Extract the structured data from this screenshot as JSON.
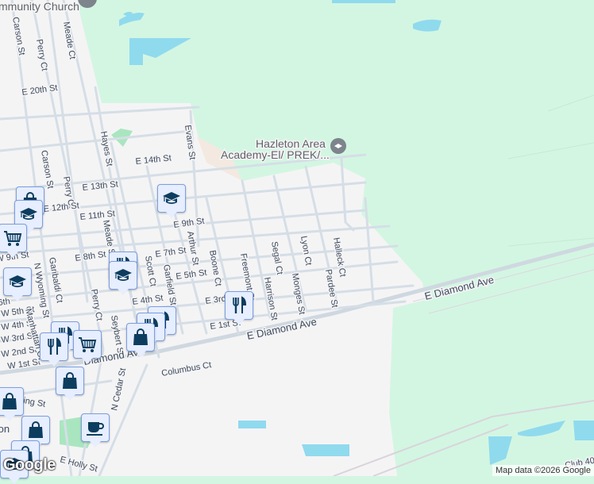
{
  "map": {
    "poi_top": "mmunity Church",
    "school_poi": {
      "line1": "Hazleton Area",
      "line2": "Academy-El/ PREK/..."
    },
    "streets": {
      "carson_n": "Carson St",
      "perry_n": "Perry Ct",
      "meade_ct": "Meade Ct",
      "e20": "E 20th St",
      "hayes": "Hayes St",
      "evans": "Evans St",
      "e14": "E 14th St",
      "e13": "E 13th St",
      "carson_s": "Carson St",
      "perry_s": "Perry Ct",
      "e12": "E 12th St",
      "e11": "E 11th St",
      "e9": "E 9th St",
      "meade_st": "Meade St",
      "arthur": "Arthur St",
      "e8": "E 8th St",
      "e7": "E 7th St",
      "scott": "Scott Ct",
      "garfield": "Garfield St",
      "e5": "E 5th St",
      "boone": "Boone Ct",
      "freemont": "Freemont St",
      "harrison": "Harrison St",
      "segal": "Segal Ct",
      "lyon": "Lyon Ct",
      "monges": "Monges St",
      "halleck": "Halleck Ct",
      "pardee": "Pardee St",
      "e4": "E 4th St",
      "e3": "E 3rd St",
      "e1": "E 1st St",
      "diamond_w": "E Diamond Ave",
      "diamond_e": "E Diamond Ave",
      "w9": "W 9th St",
      "n_wyoming": "N Wyoming St",
      "garibaldi": "Garibaldi Ct",
      "perry_ct3": "Perry Ct",
      "seybert": "Seybert St",
      "w5": "W 5th St",
      "w4": "W 4th St",
      "w3": "W 3rd St",
      "w2": "W 2nd St",
      "w1": "W 1st St",
      "manhattan": "Manhattan Ct",
      "diamond_c": "Diamond Ave",
      "columbus": "Columbus Ct",
      "n_cedar": "N Cedar St",
      "spring": "Spring St",
      "holly": "E Holly St",
      "club": "Club 40",
      "hazleton": "ton",
      "w6": "6th"
    }
  },
  "markers": [
    {
      "type": "school-icon"
    },
    {
      "type": "shopping-icon"
    },
    {
      "type": "school-icon"
    },
    {
      "type": "cart-icon"
    },
    {
      "type": "school-icon"
    },
    {
      "type": "restaurant-icon"
    },
    {
      "type": "school-icon"
    },
    {
      "type": "restaurant-icon"
    },
    {
      "type": "restaurant-icon"
    },
    {
      "type": "restaurant-icon"
    },
    {
      "type": "shopping-icon"
    },
    {
      "type": "restaurant-icon"
    },
    {
      "type": "restaurant-icon"
    },
    {
      "type": "cart-icon"
    },
    {
      "type": "shopping-icon"
    },
    {
      "type": "coffee-icon"
    },
    {
      "type": "shopping-icon"
    }
  ],
  "footer": {
    "logo": "Google",
    "attribution": "Map data ©2026 Google"
  },
  "colors": {
    "park": "#d3f6e2",
    "urban": "#f5f4f5",
    "water": "#90daee",
    "marker_icon": "#0d3d5e"
  }
}
